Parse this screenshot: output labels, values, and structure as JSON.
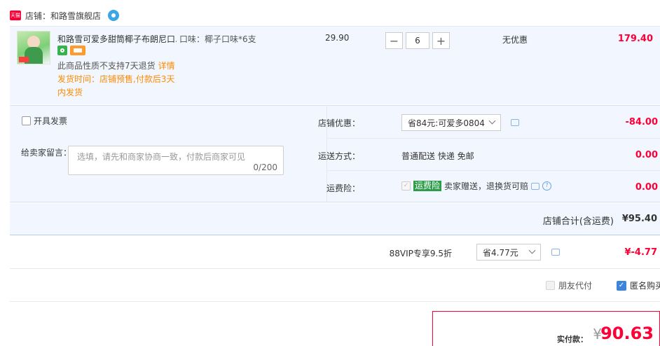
{
  "shop": {
    "badge": "天猫",
    "label": "店铺：和路雪旗舰店"
  },
  "item": {
    "title": "和路雪可爱多甜筒椰子布朗尼口...",
    "sku": "口味：椰子口味*6支",
    "unit_price": "29.90",
    "quantity": "6",
    "discount_text": "无优惠",
    "total": "179.40",
    "return_note": "此商品性质不支持7天退货",
    "return_link": "详情",
    "shipping_note": "发货时间：店铺预售,付款后3天内发货"
  },
  "options": {
    "invoice_label": "开具发票",
    "message_label": "给卖家留言：",
    "message_placeholder": "选填，请先和商家协商一致，付款后商家可见",
    "message_count": "0/200",
    "shop_coupon_label": "店铺优惠：",
    "shop_coupon_value": "省84元:可爱多0804",
    "shop_coupon_amount": "-84.00",
    "shipping_label": "运送方式：",
    "shipping_value": "普通配送 快递 免邮",
    "shipping_amount": "0.00",
    "insurance_label": "运费险：",
    "insurance_tag": "运费险",
    "insurance_text": "卖家赠送，退换货可赔",
    "insurance_amount": "0.00"
  },
  "store_total": {
    "label": "店铺合计(含运费)",
    "amount": "¥95.40"
  },
  "vip": {
    "label": "88VIP专享9.5折",
    "select_value": "省4.77元",
    "amount": "¥-4.77"
  },
  "extras": {
    "friend_pay": "朋友代付",
    "anonymous": "匿名购买"
  },
  "payment": {
    "label": "实付款：",
    "currency": "¥",
    "amount": "90.63"
  },
  "colors": {
    "accent": "#ff0036",
    "orange": "#ff8a00",
    "panel": "#f2f7ff",
    "check": "#3d85dc"
  }
}
